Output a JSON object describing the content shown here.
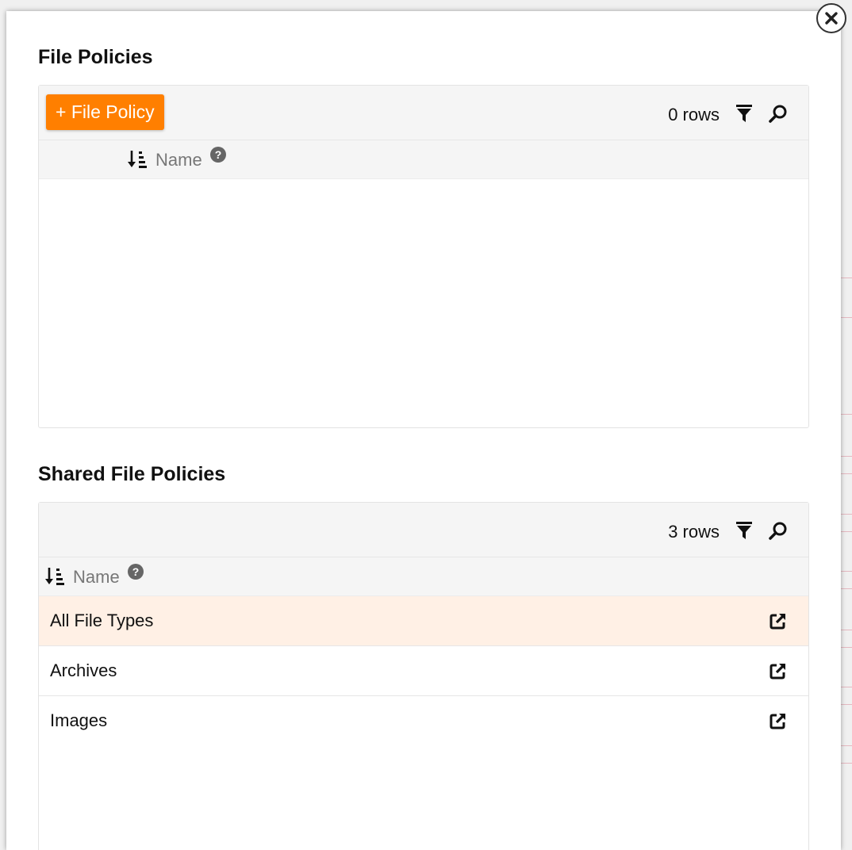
{
  "modal": {
    "close_icon": "close-icon"
  },
  "file_policies": {
    "title": "File Policies",
    "add_button_label": "+ File Policy",
    "row_count": "0 rows",
    "column_header": "Name",
    "rows": []
  },
  "shared_file_policies": {
    "title": "Shared File Policies",
    "row_count": "3 rows",
    "column_header": "Name",
    "rows": [
      {
        "label": "All File Types",
        "highlighted": true
      },
      {
        "label": "Archives",
        "highlighted": false
      },
      {
        "label": "Images",
        "highlighted": false
      }
    ]
  },
  "colors": {
    "accent": "#ff7f00",
    "row_highlight": "#fff0e5",
    "toolbar_bg": "#f5f5f5"
  },
  "icons": [
    "close-icon",
    "filter-icon",
    "search-icon",
    "sort-descending-icon",
    "help-icon",
    "open-external-icon"
  ]
}
